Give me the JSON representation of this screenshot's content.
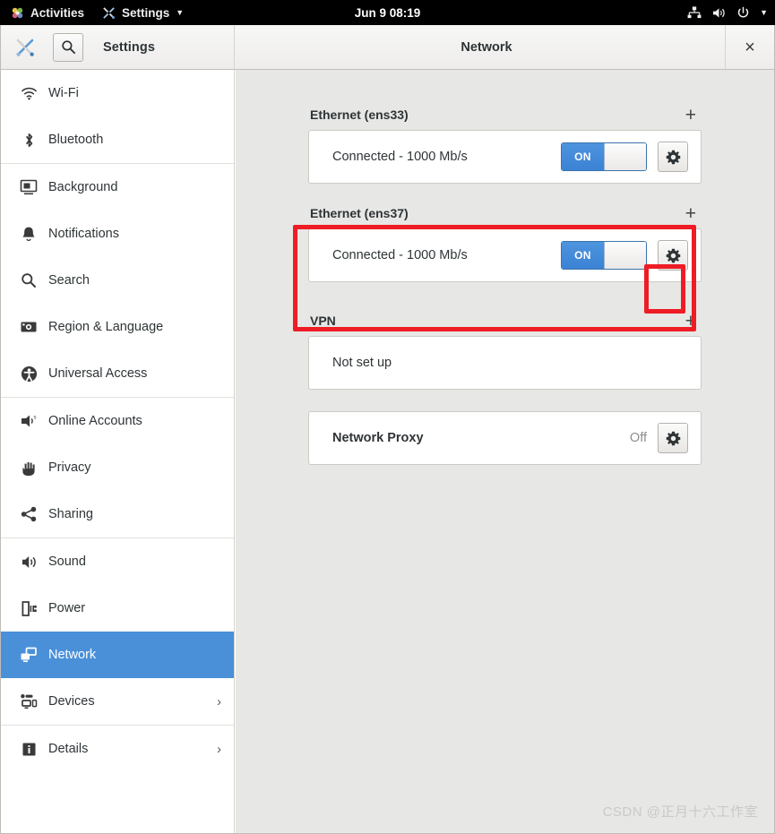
{
  "topbar": {
    "activities": "Activities",
    "app_menu": "Settings",
    "clock": "Jun 9  08:19",
    "icons": [
      "network-wired-icon",
      "volume-icon",
      "power-icon",
      "chevron-down-icon"
    ]
  },
  "headerbar": {
    "tools_icon": "tools-icon",
    "search_icon": "search-icon",
    "left_title": "Settings",
    "right_title": "Network",
    "close_label": "×"
  },
  "sidebar": {
    "items": [
      {
        "label": "Wi-Fi",
        "icon": "wifi-icon",
        "selected": false,
        "chevron": ""
      },
      {
        "label": "Bluetooth",
        "icon": "bluetooth-icon",
        "selected": false,
        "chevron": ""
      },
      {
        "label": "Background",
        "icon": "background-icon",
        "selected": false,
        "chevron": ""
      },
      {
        "label": "Notifications",
        "icon": "bell-icon",
        "selected": false,
        "chevron": ""
      },
      {
        "label": "Search",
        "icon": "search-icon",
        "selected": false,
        "chevron": ""
      },
      {
        "label": "Region & Language",
        "icon": "region-language-icon",
        "selected": false,
        "chevron": ""
      },
      {
        "label": "Universal Access",
        "icon": "universal-access-icon",
        "selected": false,
        "chevron": ""
      },
      {
        "label": "Online Accounts",
        "icon": "online-accounts-icon",
        "selected": false,
        "chevron": ""
      },
      {
        "label": "Privacy",
        "icon": "hand-icon",
        "selected": false,
        "chevron": ""
      },
      {
        "label": "Sharing",
        "icon": "sharing-icon",
        "selected": false,
        "chevron": ""
      },
      {
        "label": "Sound",
        "icon": "sound-icon",
        "selected": false,
        "chevron": ""
      },
      {
        "label": "Power",
        "icon": "power-plug-icon",
        "selected": false,
        "chevron": ""
      },
      {
        "label": "Network",
        "icon": "network-icon",
        "selected": true,
        "chevron": ""
      },
      {
        "label": "Devices",
        "icon": "devices-icon",
        "selected": false,
        "chevron": "›"
      },
      {
        "label": "Details",
        "icon": "info-icon",
        "selected": false,
        "chevron": "›"
      }
    ]
  },
  "content": {
    "groups": [
      {
        "title": "Ethernet (ens33)",
        "add_label": "+",
        "rows": [
          {
            "label": "Connected - 1000 Mb/s",
            "toggle": "ON",
            "gear": "gear-icon",
            "bold": false,
            "status": ""
          }
        ]
      },
      {
        "title": "Ethernet (ens37)",
        "add_label": "+",
        "rows": [
          {
            "label": "Connected - 1000 Mb/s",
            "toggle": "ON",
            "gear": "gear-icon",
            "bold": false,
            "status": ""
          }
        ]
      },
      {
        "title": "VPN",
        "add_label": "+",
        "rows": [
          {
            "label": "Not set up",
            "toggle": "",
            "gear": "",
            "bold": false,
            "status": ""
          }
        ]
      }
    ],
    "proxy": {
      "label": "Network Proxy",
      "status": "Off",
      "gear": "gear-icon"
    }
  },
  "annotations": {
    "color": "#ee1c25",
    "ens37_section": "highlight-ethernet-ens37",
    "gear_button": "highlight-gear-button"
  },
  "watermark": "CSDN @正月十六工作室"
}
